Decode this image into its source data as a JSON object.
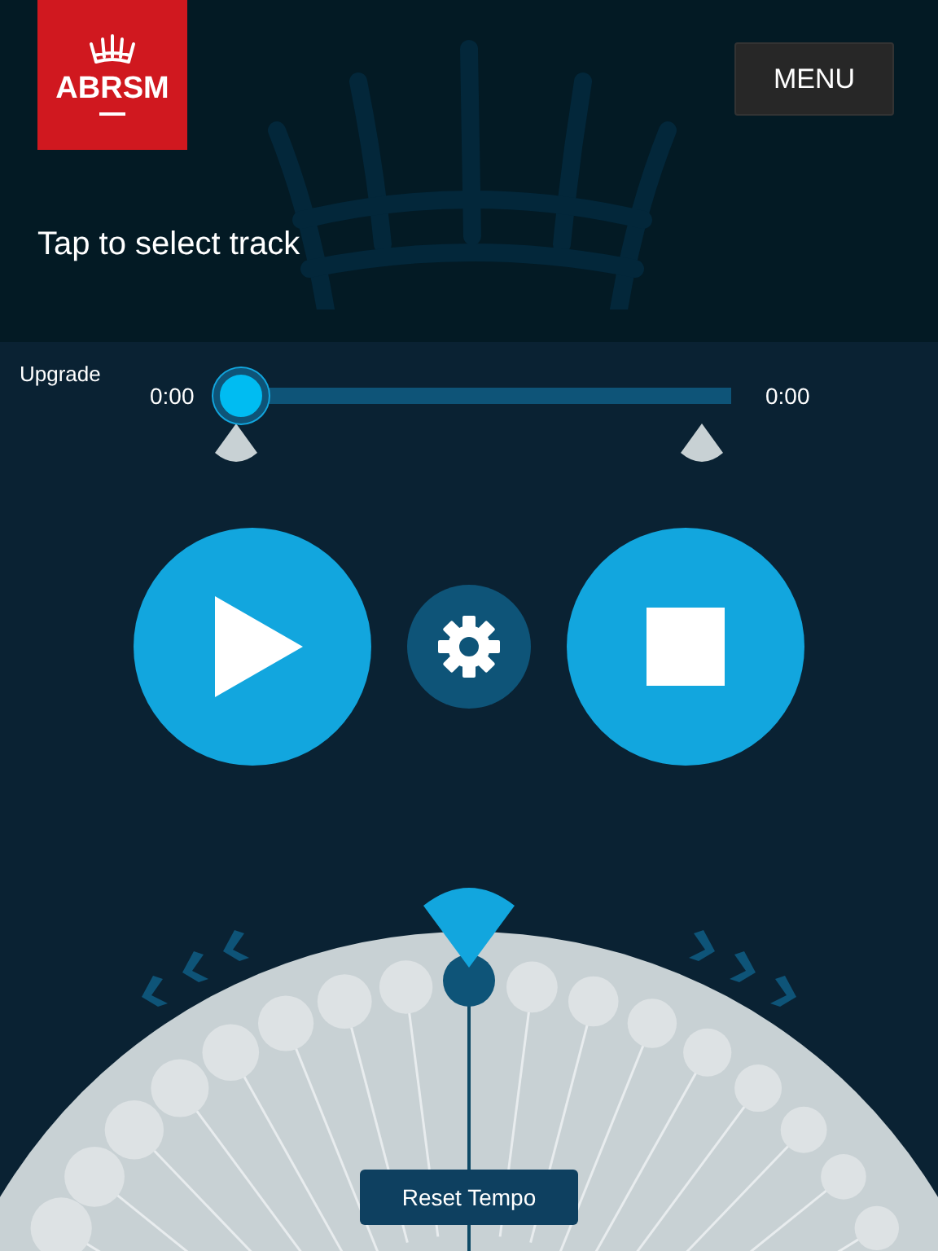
{
  "header": {
    "logo": {
      "text": "ABRSM"
    },
    "menu_button": "MENU",
    "track_prompt": "Tap to select track"
  },
  "player": {
    "upgrade_link": "Upgrade",
    "elapsed": "0:00",
    "remaining": "0:00",
    "progress": {
      "level": 0
    }
  },
  "tempo": {
    "reset_button": "Reset Tempo"
  }
}
